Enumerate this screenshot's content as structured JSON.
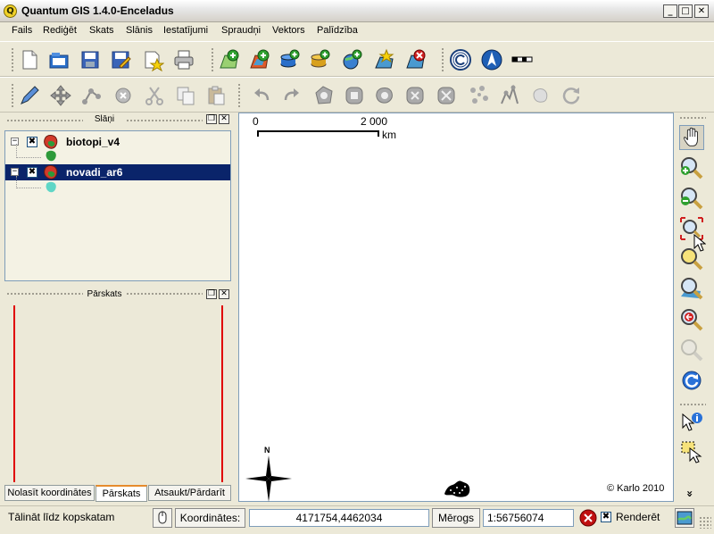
{
  "window": {
    "title": "Quantum GIS 1.4.0-Enceladus",
    "app_icon_letter": "Q",
    "minimize": "_",
    "maximize": "□",
    "close": "✕"
  },
  "menu": {
    "items": [
      "Fails",
      "Rediģēt",
      "Skats",
      "Slānis",
      "Iestatījumi",
      "Spraudņi",
      "Vektors",
      "Palīdzība"
    ]
  },
  "toolbar1": {
    "icons": [
      "new-project-icon",
      "open-project-icon",
      "save-project-icon",
      "save-as-icon",
      "new-print-composer-icon",
      "print-icon",
      "add-vector-layer-icon",
      "add-raster-layer-icon",
      "add-postgis-layer-icon",
      "add-spatialite-layer-icon",
      "add-wms-layer-icon",
      "new-vector-layer-icon",
      "remove-layer-icon",
      "copyright-label-icon",
      "north-arrow-icon",
      "scale-bar-icon"
    ]
  },
  "toolbar2": {
    "icons": [
      "toggle-editing-icon",
      "move-feature-icon",
      "node-tool-icon",
      "delete-selected-icon",
      "cut-features-icon",
      "copy-features-icon",
      "paste-features-icon",
      "undo-icon",
      "redo-icon",
      "add-ring-icon",
      "add-island-icon",
      "delete-ring-icon",
      "delete-part-icon",
      "reshape-icon",
      "split-features-icon",
      "simplify-icon",
      "merge-features-icon",
      "rotate-point-symbols-icon"
    ]
  },
  "layers_panel": {
    "title": "Slāņi",
    "layers": [
      {
        "name": "biotopi_v4",
        "checked": "✖",
        "expander": "−",
        "color": "#2e9a3a",
        "selected": false
      },
      {
        "name": "novadi_ar6",
        "checked": "✖",
        "expander": "−",
        "color": "#5fd6c6",
        "selected": true
      }
    ],
    "float_btn": "❐",
    "close_btn": "✕"
  },
  "overview_panel": {
    "title": "Pārskats",
    "float_btn": "❐",
    "close_btn": "✕",
    "extent_color": "#e00000"
  },
  "tabs": {
    "items": [
      "Nolasīt koordinātes",
      "Pārskats",
      "Atsaukt/Pārdarīt"
    ],
    "active": "Pārskats"
  },
  "map": {
    "scalebar_zero": "0",
    "scalebar_max": "2 000",
    "scalebar_unit": "km",
    "north_label": "N",
    "copyright": "© Karlo 2010"
  },
  "right_toolbar": {
    "icons": [
      "pan-icon",
      "zoom-in-icon",
      "zoom-out-icon",
      "zoom-full-icon",
      "zoom-to-selection-icon",
      "zoom-to-layer-icon",
      "zoom-last-icon",
      "zoom-next-icon",
      "refresh-icon",
      "identify-icon",
      "select-features-icon"
    ],
    "more": "»"
  },
  "statusbar": {
    "message": "Tālināt līdz kopskatam",
    "coords_label": "Koordinātes:",
    "coords_value": "4171754,4462034",
    "scale_label": "Mērogs",
    "scale_value": "1:56756074",
    "render_label": "Renderēt",
    "render_check": "✖"
  }
}
